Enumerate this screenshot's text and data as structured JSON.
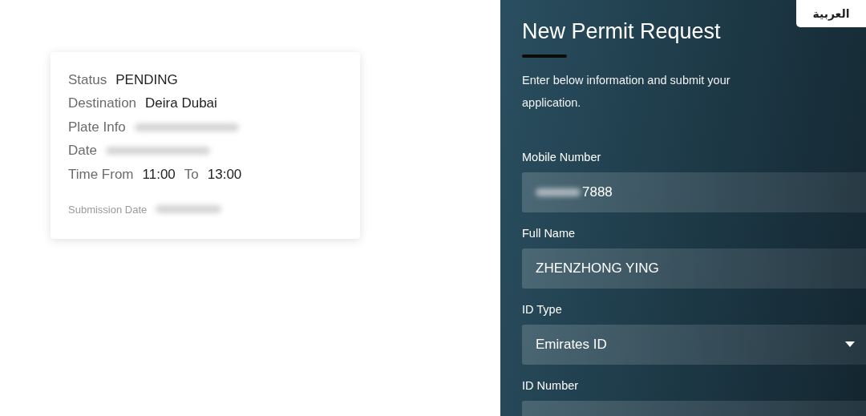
{
  "language_button": {
    "label": "العربية"
  },
  "permit_card": {
    "rows": [
      {
        "kind": "pair",
        "label": "Status",
        "value": "PENDING"
      },
      {
        "kind": "pair",
        "label": "Destination",
        "value": "Deira Dubai"
      },
      {
        "kind": "redacted",
        "label": "Plate Info"
      },
      {
        "kind": "redacted",
        "label": "Date"
      },
      {
        "kind": "time",
        "label": "Time From",
        "from": "11:00",
        "to_label": "To",
        "to": "13:00"
      }
    ],
    "submission": {
      "kind": "redacted",
      "label": "Submission Date"
    }
  },
  "form": {
    "title": "New Permit Request",
    "description": "Enter below information and submit your application.",
    "fields": [
      {
        "kind": "input",
        "label": "Mobile Number",
        "value": "7888",
        "redacted_prefix": true
      },
      {
        "kind": "input",
        "label": "Full Name",
        "value": "ZHENZHONG YING",
        "redacted_prefix": false
      },
      {
        "kind": "select",
        "label": "ID Type",
        "value": "Emirates ID"
      },
      {
        "kind": "input",
        "label": "ID Number"
      }
    ]
  }
}
